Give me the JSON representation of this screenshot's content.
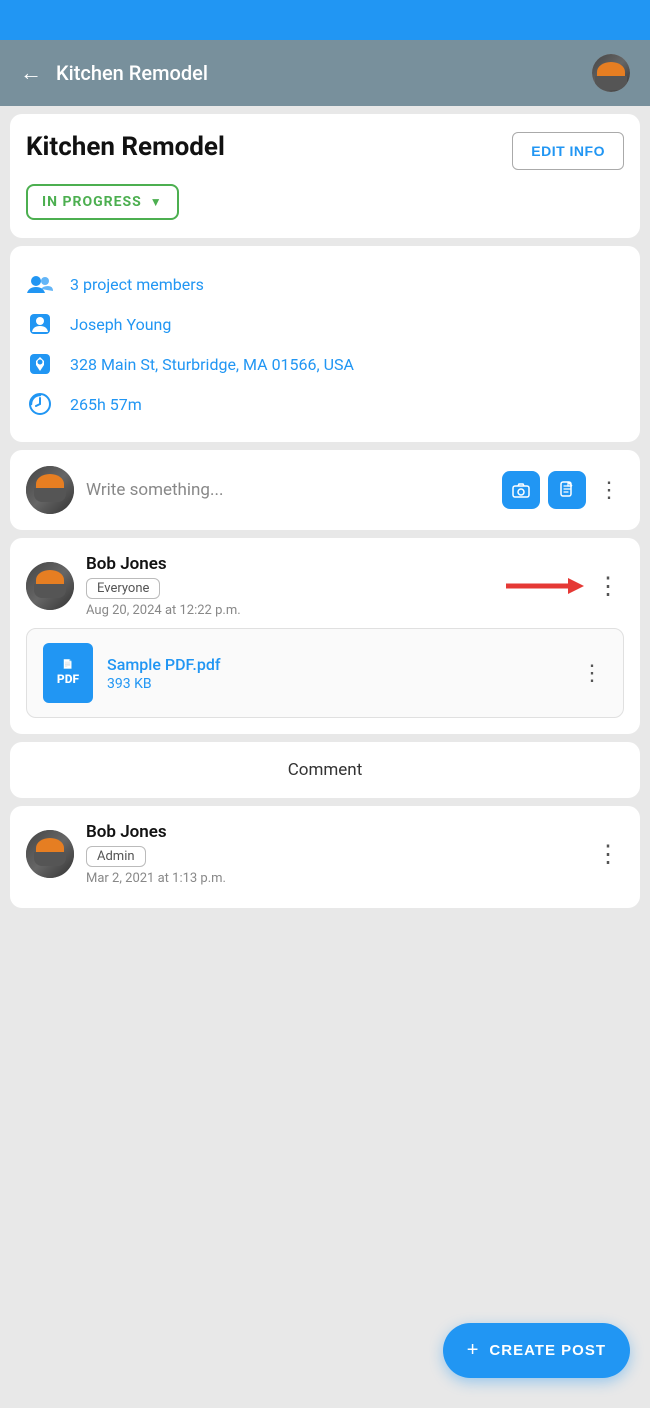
{
  "app": {
    "title": "Kitchen Remodel",
    "back_label": "←"
  },
  "project": {
    "name": "Kitchen Remodel",
    "edit_info_label": "EDIT INFO",
    "status": "IN PROGRESS",
    "members_count": "3",
    "members_label": "project members",
    "owner": "Joseph Young",
    "address": "328 Main St, Sturbridge, MA 01566, USA",
    "time_logged": "265h 57m"
  },
  "compose": {
    "placeholder": "Write something...",
    "camera_icon": "📷",
    "attachment_icon": "📎"
  },
  "posts": [
    {
      "author": "Bob Jones",
      "badge": "Everyone",
      "timestamp": "Aug 20, 2024 at 12:22 p.m.",
      "attachment": {
        "name": "Sample PDF.pdf",
        "size": "393 KB",
        "type": "PDF"
      }
    },
    {
      "author": "Bob Jones",
      "badge": "Admin",
      "timestamp": "Mar 2, 2021 at 1:13 p.m."
    }
  ],
  "comment_label": "Comment",
  "create_post_label": "CREATE POST",
  "colors": {
    "blue": "#2196F3",
    "green": "#4CAF50",
    "red": "#e53935"
  }
}
